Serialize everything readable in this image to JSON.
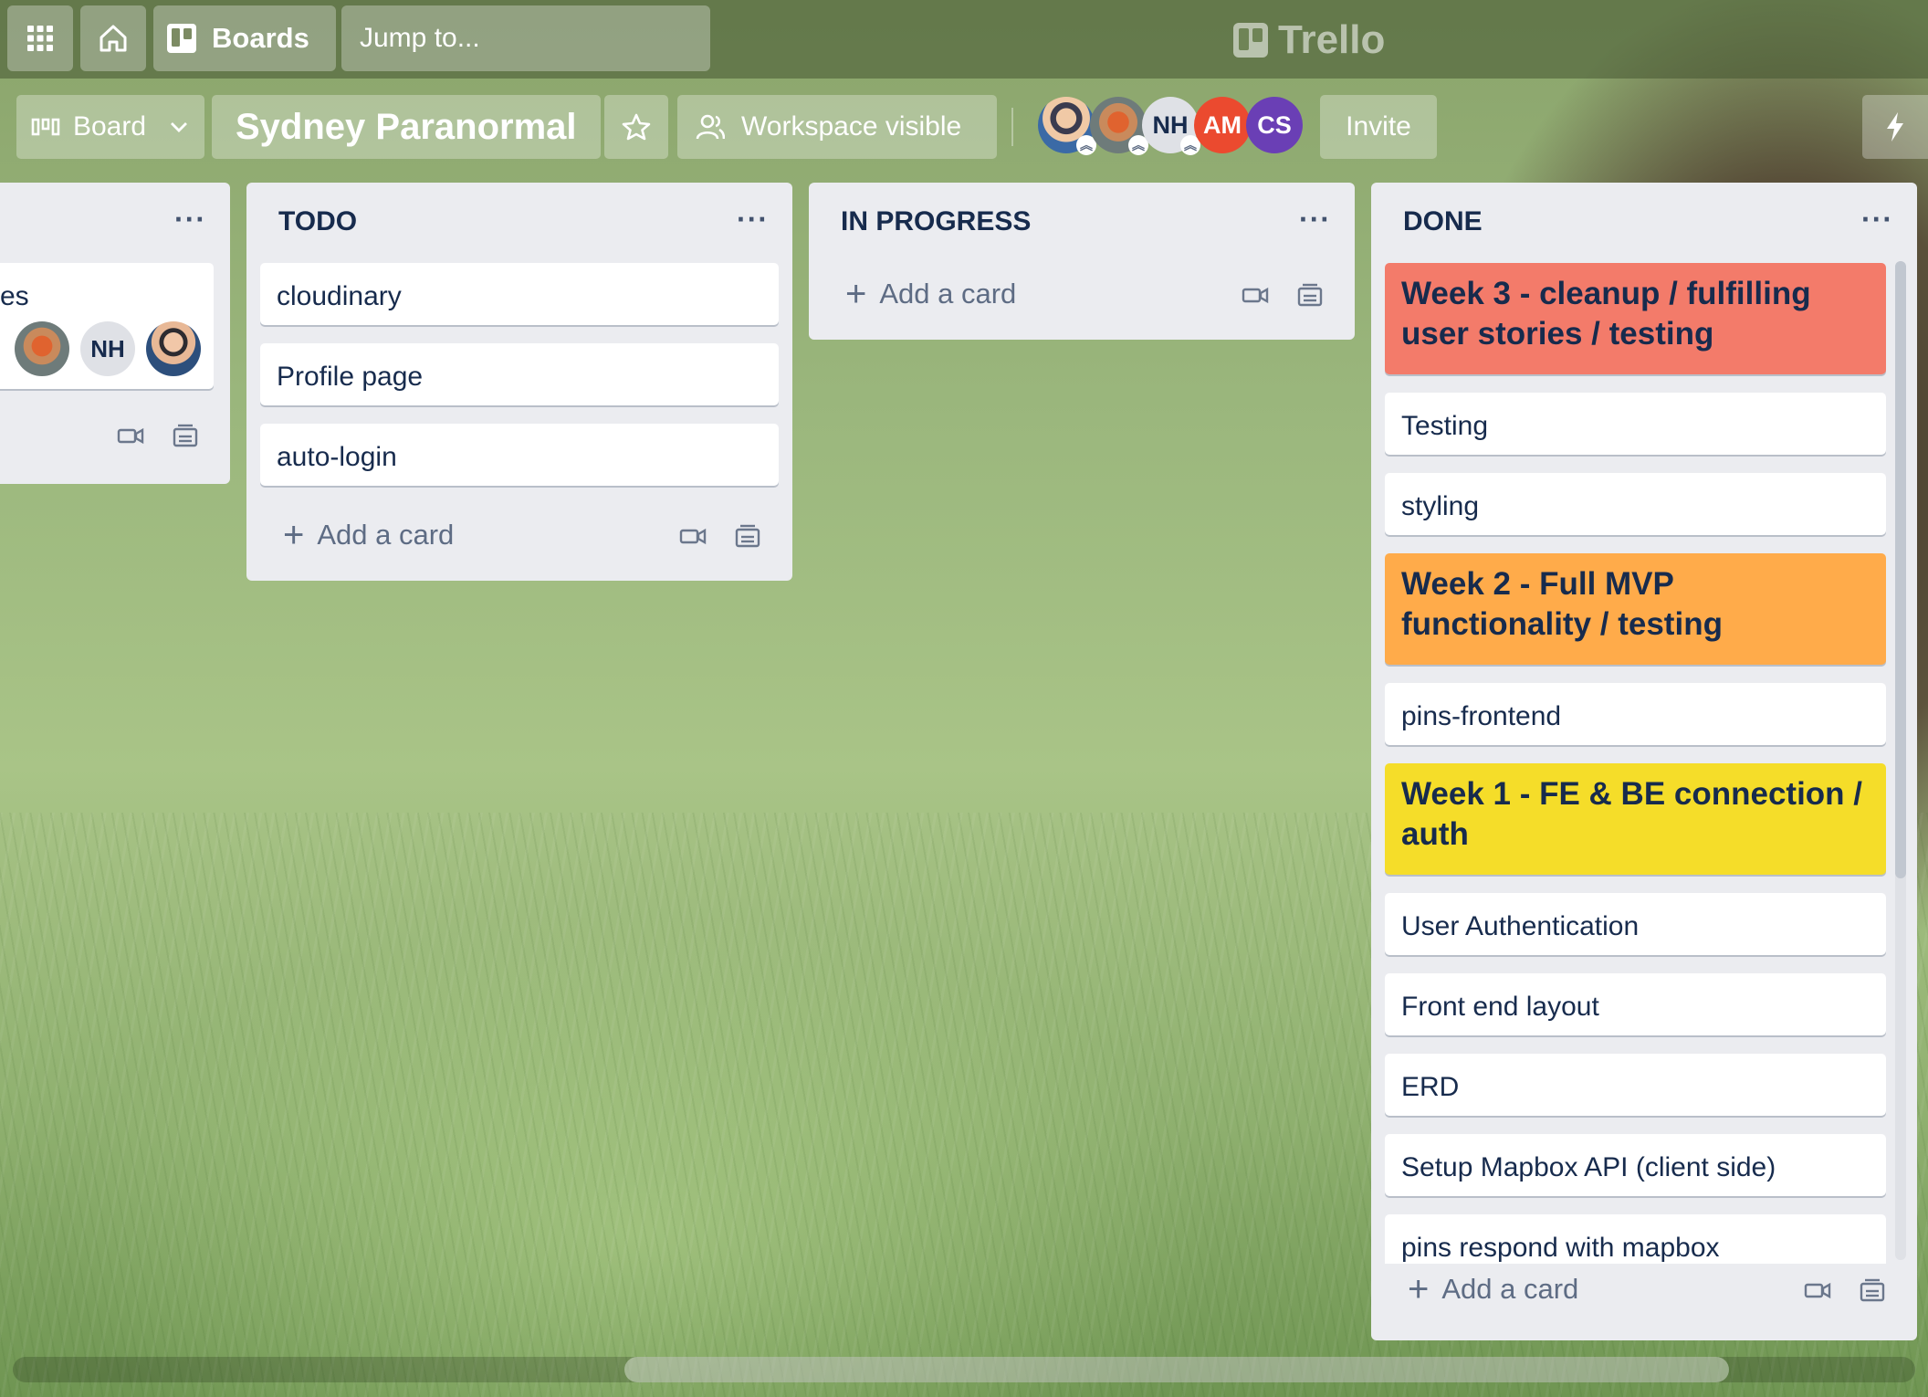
{
  "topnav": {
    "apps_icon": "grid-icon",
    "home_icon": "home-icon",
    "boards_label": "Boards",
    "search_placeholder": "Jump to...",
    "logo_text": "Trello"
  },
  "board_header": {
    "view_label": "Board",
    "title": "Sydney Paranormal",
    "visibility_label": "Workspace visible",
    "members": [
      "",
      "",
      "NH",
      "AM",
      "CS"
    ],
    "member_colors": {
      "AM": "#eb4a2f",
      "CS": "#6a3fb5",
      "NH": "#dfe1e6"
    },
    "invite_label": "Invite"
  },
  "lists": [
    {
      "title": "",
      "card_fragment": "es",
      "member_initials": "NH"
    },
    {
      "title": "TODO",
      "cards": [
        "cloudinary",
        "Profile page",
        "auto-login"
      ],
      "add_label": "Add a card"
    },
    {
      "title": "IN PROGRESS",
      "cards": [],
      "add_label": "Add a card"
    },
    {
      "title": "DONE",
      "cards": [
        {
          "text": "Week 3 - cleanup / fulfilling user stories / testing",
          "color": "#f37b6a"
        },
        {
          "text": "Testing"
        },
        {
          "text": "styling"
        },
        {
          "text": "Week 2 - Full MVP functionality / testing",
          "color": "#ffab4a"
        },
        {
          "text": "pins-frontend"
        },
        {
          "text": "Week 1 - FE & BE connection / auth",
          "color": "#f5dd29"
        },
        {
          "text": "User Authentication"
        },
        {
          "text": "Front end layout"
        },
        {
          "text": "ERD"
        },
        {
          "text": "Setup Mapbox API (client side)"
        },
        {
          "text": "pins respond with mapbox"
        }
      ],
      "add_label": "Add a card"
    }
  ]
}
